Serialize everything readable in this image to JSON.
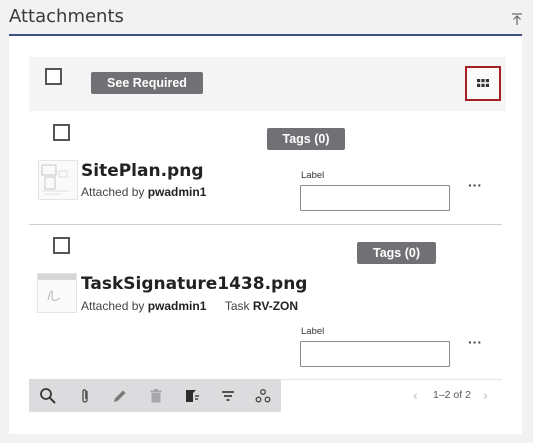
{
  "panel": {
    "title": "Attachments"
  },
  "toolbar": {
    "see_required_label": "See Required",
    "grid_view_icon": "grid-icon"
  },
  "attachments": [
    {
      "tags_label": "Tags (0)",
      "filename": "SitePlan.png",
      "attached_by_prefix": "Attached by",
      "attached_by_user": "pwadmin1",
      "task_prefix": "",
      "task_value": "",
      "label_caption": "Label",
      "label_value": "",
      "more_label": "···"
    },
    {
      "tags_label": "Tags (0)",
      "filename": "TaskSignature1438.png",
      "attached_by_prefix": "Attached by",
      "attached_by_user": "pwadmin1",
      "task_prefix": "Task",
      "task_value": "RV-ZON",
      "label_caption": "Label",
      "label_value": "",
      "more_label": "···"
    }
  ],
  "actions": {
    "icons": [
      "search-icon",
      "paperclip-icon",
      "pencil-icon",
      "trash-icon",
      "document-tag-icon",
      "filter-icon",
      "settings-cluster-icon"
    ]
  },
  "pager": {
    "range_text": "1–2 of 2"
  },
  "colors": {
    "title_rule": "#3e4f84",
    "dark_button": "#717175",
    "grid_button_border": "#a41e22"
  }
}
